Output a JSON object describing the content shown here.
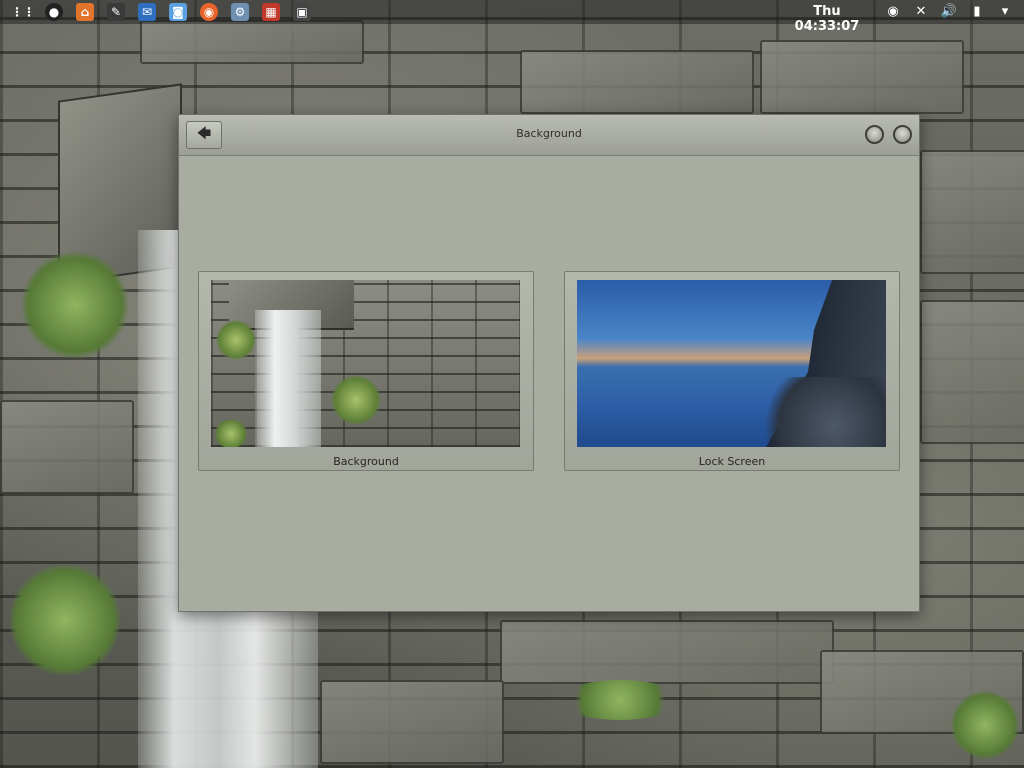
{
  "top_panel": {
    "clock": "Thu 04:33:07",
    "launcher_icons": [
      {
        "name": "apps-grid-icon",
        "glyph": "⋮⋮"
      },
      {
        "name": "app-circle-icon",
        "glyph": "●"
      },
      {
        "name": "home-folder-icon",
        "glyph": "⌂"
      },
      {
        "name": "app-puzzle-icon",
        "glyph": "✎"
      },
      {
        "name": "app-mail-icon",
        "glyph": "✉"
      },
      {
        "name": "app-photo-icon",
        "glyph": "◙"
      },
      {
        "name": "firefox-icon",
        "glyph": "◉"
      },
      {
        "name": "app-gear-icon",
        "glyph": "⚙"
      },
      {
        "name": "app-chart-icon",
        "glyph": "▦"
      },
      {
        "name": "app-frame-icon",
        "glyph": "▣"
      }
    ],
    "tray_icons": [
      {
        "name": "status-indicator-icon",
        "glyph": "◉"
      },
      {
        "name": "network-icon",
        "glyph": "✕"
      },
      {
        "name": "volume-icon",
        "glyph": "🔊"
      },
      {
        "name": "battery-icon",
        "glyph": "▮"
      },
      {
        "name": "menu-chevron-icon",
        "glyph": "▾"
      }
    ]
  },
  "window": {
    "title": "Background",
    "back_glyph": "🡄",
    "tiles": [
      {
        "label": "Background"
      },
      {
        "label": "Lock Screen"
      }
    ]
  }
}
